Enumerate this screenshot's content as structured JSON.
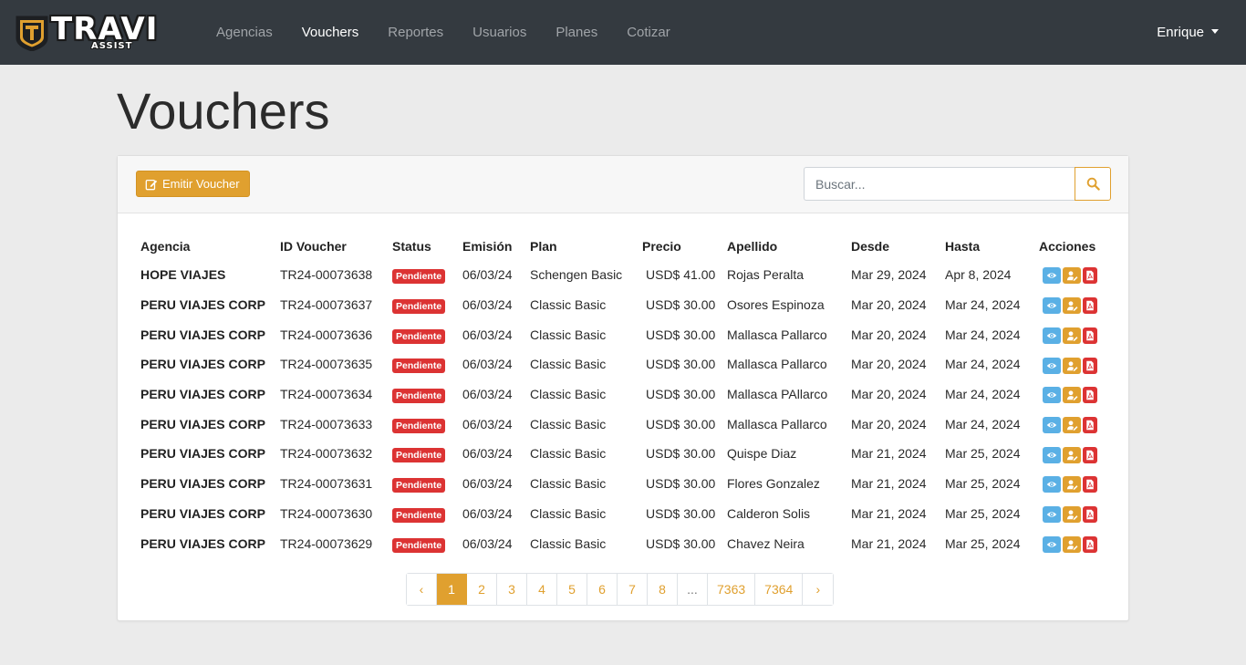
{
  "brand": {
    "name": "TRAVI",
    "sub": "ASSIST",
    "colors": {
      "gold": "#e0a02f",
      "dark": "#343a40",
      "danger": "#dc3333",
      "info": "#5ab0e5"
    }
  },
  "nav": {
    "items": [
      {
        "label": "Agencias",
        "active": false
      },
      {
        "label": "Vouchers",
        "active": true
      },
      {
        "label": "Reportes",
        "active": false
      },
      {
        "label": "Usuarios",
        "active": false
      },
      {
        "label": "Planes",
        "active": false
      },
      {
        "label": "Cotizar",
        "active": false
      }
    ],
    "user": "Enrique"
  },
  "page": {
    "title": "Vouchers"
  },
  "toolbar": {
    "emit_label": "Emitir Voucher",
    "search_placeholder": "Buscar..."
  },
  "table": {
    "headers": [
      "Agencia",
      "ID Voucher",
      "Status",
      "Emisión",
      "Plan",
      "Precio",
      "Apellido",
      "Desde",
      "Hasta",
      "Acciones"
    ],
    "rows": [
      {
        "agencia": "HOPE VIAJES",
        "id": "TR24-00073638",
        "status": "Pendiente",
        "emision": "06/03/24",
        "plan": "Schengen Basic",
        "precio": "USD$ 41.00",
        "apellido": "Rojas Peralta",
        "desde": "Mar 29, 2024",
        "hasta": "Apr 8, 2024"
      },
      {
        "agencia": "PERU VIAJES CORP",
        "id": "TR24-00073637",
        "status": "Pendiente",
        "emision": "06/03/24",
        "plan": "Classic Basic",
        "precio": "USD$ 30.00",
        "apellido": "Osores Espinoza",
        "desde": "Mar 20, 2024",
        "hasta": "Mar 24, 2024"
      },
      {
        "agencia": "PERU VIAJES CORP",
        "id": "TR24-00073636",
        "status": "Pendiente",
        "emision": "06/03/24",
        "plan": "Classic Basic",
        "precio": "USD$ 30.00",
        "apellido": "Mallasca Pallarco",
        "desde": "Mar 20, 2024",
        "hasta": "Mar 24, 2024"
      },
      {
        "agencia": "PERU VIAJES CORP",
        "id": "TR24-00073635",
        "status": "Pendiente",
        "emision": "06/03/24",
        "plan": "Classic Basic",
        "precio": "USD$ 30.00",
        "apellido": "Mallasca Pallarco",
        "desde": "Mar 20, 2024",
        "hasta": "Mar 24, 2024"
      },
      {
        "agencia": "PERU VIAJES CORP",
        "id": "TR24-00073634",
        "status": "Pendiente",
        "emision": "06/03/24",
        "plan": "Classic Basic",
        "precio": "USD$ 30.00",
        "apellido": "Mallasca PAllarco",
        "desde": "Mar 20, 2024",
        "hasta": "Mar 24, 2024"
      },
      {
        "agencia": "PERU VIAJES CORP",
        "id": "TR24-00073633",
        "status": "Pendiente",
        "emision": "06/03/24",
        "plan": "Classic Basic",
        "precio": "USD$ 30.00",
        "apellido": "Mallasca Pallarco",
        "desde": "Mar 20, 2024",
        "hasta": "Mar 24, 2024"
      },
      {
        "agencia": "PERU VIAJES CORP",
        "id": "TR24-00073632",
        "status": "Pendiente",
        "emision": "06/03/24",
        "plan": "Classic Basic",
        "precio": "USD$ 30.00",
        "apellido": "Quispe Diaz",
        "desde": "Mar 21, 2024",
        "hasta": "Mar 25, 2024"
      },
      {
        "agencia": "PERU VIAJES CORP",
        "id": "TR24-00073631",
        "status": "Pendiente",
        "emision": "06/03/24",
        "plan": "Classic Basic",
        "precio": "USD$ 30.00",
        "apellido": "Flores Gonzalez",
        "desde": "Mar 21, 2024",
        "hasta": "Mar 25, 2024"
      },
      {
        "agencia": "PERU VIAJES CORP",
        "id": "TR24-00073630",
        "status": "Pendiente",
        "emision": "06/03/24",
        "plan": "Classic Basic",
        "precio": "USD$ 30.00",
        "apellido": "Calderon Solis",
        "desde": "Mar 21, 2024",
        "hasta": "Mar 25, 2024"
      },
      {
        "agencia": "PERU VIAJES CORP",
        "id": "TR24-00073629",
        "status": "Pendiente",
        "emision": "06/03/24",
        "plan": "Classic Basic",
        "precio": "USD$ 30.00",
        "apellido": "Chavez Neira",
        "desde": "Mar 21, 2024",
        "hasta": "Mar 25, 2024"
      }
    ],
    "row_actions": [
      "eye-icon",
      "user-edit-icon",
      "pdf-icon"
    ]
  },
  "pagination": {
    "prev": "‹",
    "next": "›",
    "pages": [
      "1",
      "2",
      "3",
      "4",
      "5",
      "6",
      "7",
      "8",
      "...",
      "7363",
      "7364"
    ],
    "current": "1"
  }
}
